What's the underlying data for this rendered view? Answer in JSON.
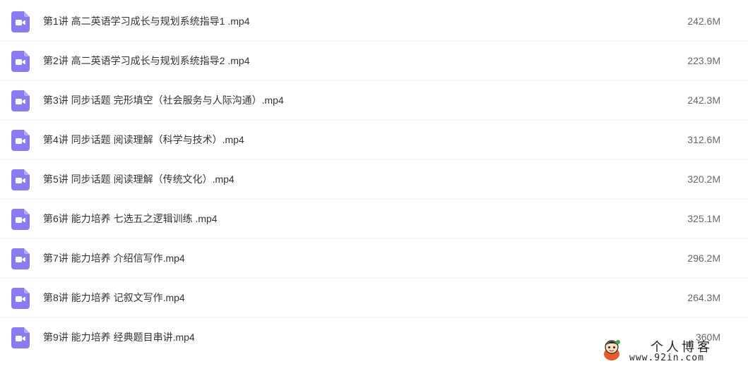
{
  "colors": {
    "video_icon": "#8a7cf0",
    "text": "#333333",
    "size_text": "#666666",
    "divider": "#f0f0f0"
  },
  "files": [
    {
      "icon": "video-file-icon",
      "name": "第1讲 高二英语学习成长与规划系统指导1 .mp4",
      "size": "242.6M"
    },
    {
      "icon": "video-file-icon",
      "name": "第2讲 高二英语学习成长与规划系统指导2 .mp4",
      "size": "223.9M"
    },
    {
      "icon": "video-file-icon",
      "name": "第3讲 同步话题 完形填空（社会服务与人际沟通）.mp4",
      "size": "242.3M"
    },
    {
      "icon": "video-file-icon",
      "name": "第4讲 同步话题 阅读理解（科学与技术）.mp4",
      "size": "312.6M"
    },
    {
      "icon": "video-file-icon",
      "name": "第5讲 同步话题 阅读理解（传统文化）.mp4",
      "size": "320.2M"
    },
    {
      "icon": "video-file-icon",
      "name": "第6讲 能力培养 七选五之逻辑训练 .mp4",
      "size": "325.1M"
    },
    {
      "icon": "video-file-icon",
      "name": "第7讲 能力培养 介绍信写作.mp4",
      "size": "296.2M"
    },
    {
      "icon": "video-file-icon",
      "name": "第8讲 能力培养 记叙文写作.mp4",
      "size": "264.3M"
    },
    {
      "icon": "video-file-icon",
      "name": "第9讲 能力培养 经典题目串讲.mp4",
      "size": "360M"
    }
  ],
  "watermark": {
    "title": "个人博客",
    "url": "www.92in.com",
    "logo_icon": "mascot-logo"
  }
}
